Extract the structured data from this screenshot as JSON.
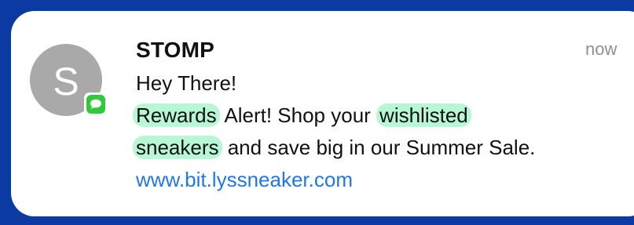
{
  "notification": {
    "avatar_letter": "S",
    "app_icon": "messages-icon",
    "sender": "STOMP",
    "time": "now",
    "greeting": "Hey There!",
    "rewards": "Rewards",
    "alert_text": " Alert! Shop your ",
    "wishlisted": "wishlisted",
    "sneakers": "sneakers",
    "save_text": " and save big in our Summer Sale.",
    "link": "www.bit.lyssneaker.com"
  },
  "colors": {
    "background": "#0b3aa3",
    "card": "#ffffff",
    "highlight": "#b7f7d5",
    "link": "#1f78e6",
    "avatar": "#a9a9aa",
    "app_badge": "#30c93a"
  }
}
